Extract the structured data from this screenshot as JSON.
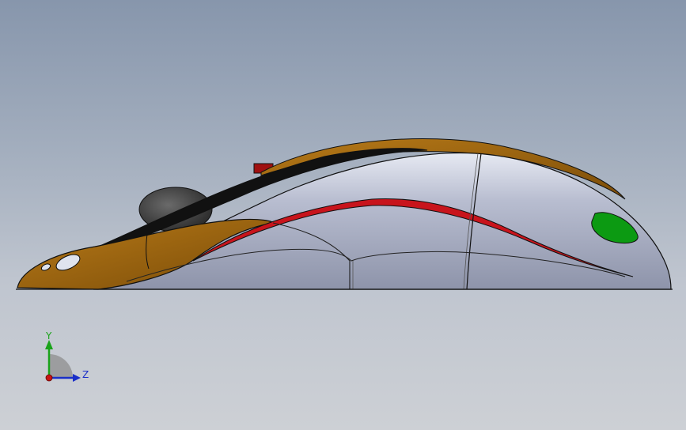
{
  "view": {
    "background_top": "#8796ac",
    "background_bottom": "#cdd0d5"
  },
  "model": {
    "name_icon": "mouse-3d-model",
    "colors": {
      "body": "#aab0c4",
      "body_highlight": "#e4e7f0",
      "shell_brown": "#9b6410",
      "accent_red": "#c8141c",
      "accent_green": "#0c9a12",
      "wheel": "#3a3a3a",
      "edge": "#111111"
    }
  },
  "triad": {
    "y_label": "Y",
    "z_label": "Z",
    "y_color": "#1aa31a",
    "z_color": "#1a2fc8",
    "x_color": "#c81414"
  }
}
